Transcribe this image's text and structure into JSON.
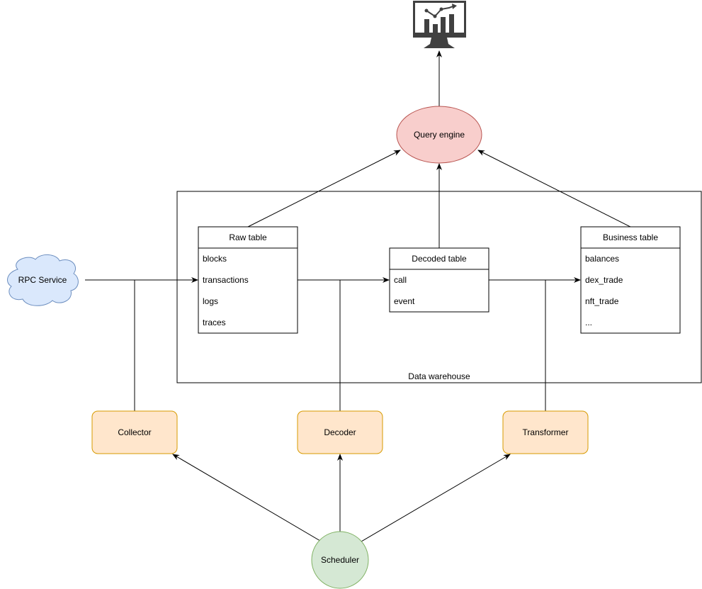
{
  "query_engine": {
    "label": "Query engine",
    "fill": "#f8cecc",
    "stroke": "#b85450"
  },
  "dashboard": {
    "icon": "monitor-chart-icon",
    "color": "#404040"
  },
  "warehouse": {
    "label": "Data warehouse"
  },
  "rpc": {
    "label": "RPC Service",
    "fill": "#dae8fc",
    "stroke": "#6c8ebf"
  },
  "tables": {
    "raw": {
      "title": "Raw table",
      "rows": [
        "blocks",
        "transactions",
        "logs",
        "traces"
      ]
    },
    "decoded": {
      "title": "Decoded table",
      "rows": [
        "call",
        "event"
      ]
    },
    "business": {
      "title": "Business table",
      "rows": [
        "balances",
        "dex_trade",
        "nft_trade",
        "..."
      ]
    }
  },
  "workers": {
    "collector": "Collector",
    "decoder": "Decoder",
    "transformer": "Transformer",
    "fill": "#ffe6cc",
    "stroke": "#d79b00"
  },
  "scheduler": {
    "label": "Scheduler",
    "fill": "#d5e8d4",
    "stroke": "#82b366"
  }
}
